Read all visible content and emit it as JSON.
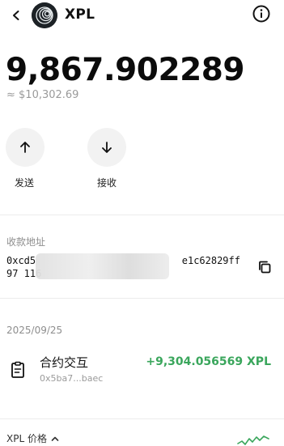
{
  "header": {
    "token_symbol": "XPL",
    "back_icon": "chevron-left-icon",
    "info_icon": "info-circle-icon"
  },
  "balance": {
    "amount": "9,867.902289",
    "fiat": "≈ $10,302.69"
  },
  "actions": [
    {
      "label": "发送",
      "icon": "arrow-up-icon"
    },
    {
      "label": "接收",
      "icon": "arrow-down-icon"
    }
  ],
  "receive": {
    "label": "收款地址",
    "address_visible_line1": "0xcd5                         e1c62829ff",
    "address_visible_line2": "97 116",
    "copy_icon": "copy-icon"
  },
  "history": {
    "date": "2025/09/25",
    "items": [
      {
        "title": "合约交互",
        "counterparty": "0x5ba7...baec",
        "amount": "+9,304.056569 XPL",
        "icon": "clipboard-icon"
      }
    ]
  },
  "price": {
    "label": "XPL 价格",
    "toggle_icon": "chevron-up-icon"
  },
  "colors": {
    "positive": "#3aa65c",
    "muted": "#9a9a9a",
    "action_bg": "#f2f2f2"
  }
}
